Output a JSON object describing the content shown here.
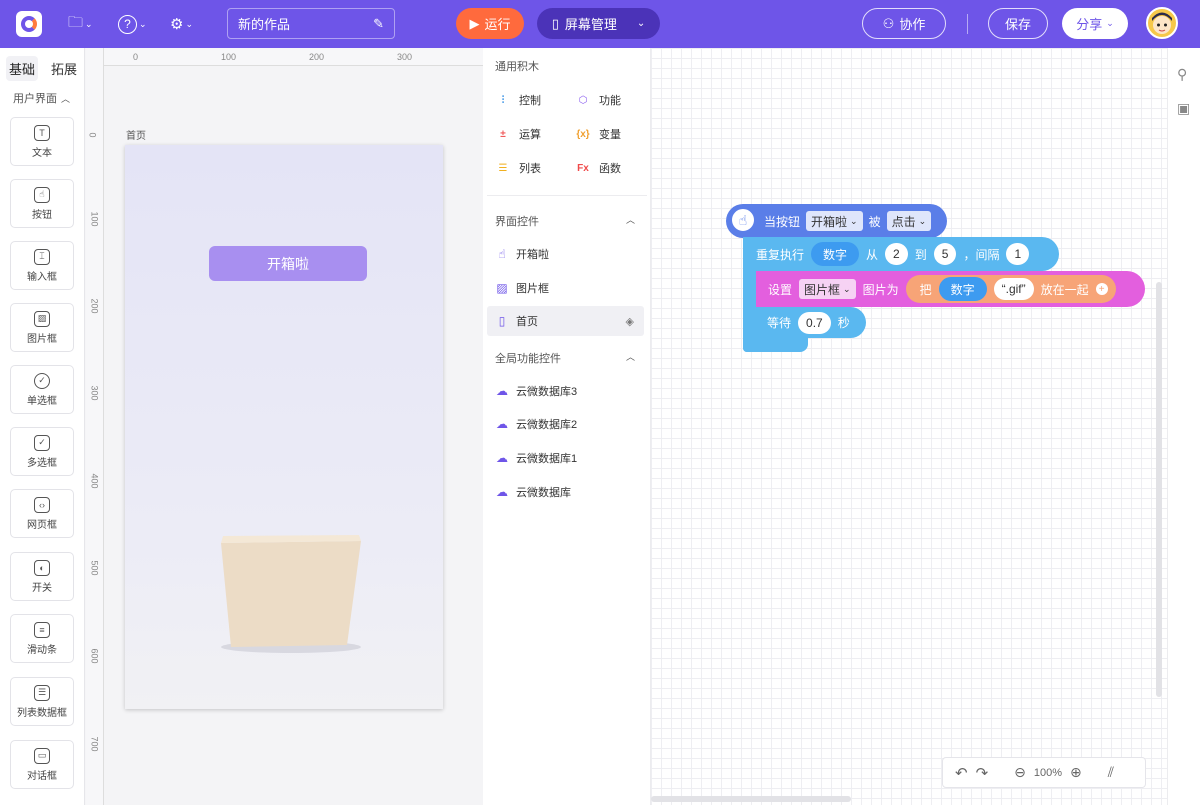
{
  "topbar": {
    "title_value": "新的作品",
    "run_label": "运行",
    "screen_manage_label": "屏幕管理",
    "collab_label": "协作",
    "save_label": "保存",
    "share_label": "分享"
  },
  "left_panel": {
    "tabs": [
      "基础",
      "拓展"
    ],
    "group_title": "用户界面",
    "components": [
      "文本",
      "按钮",
      "输入框",
      "图片框",
      "单选框",
      "多选框",
      "网页框",
      "开关",
      "滑动条",
      "列表数据框",
      "对话框"
    ]
  },
  "canvas": {
    "ruler_top": [
      "0",
      "100",
      "200",
      "300"
    ],
    "ruler_left": [
      "0",
      "100",
      "200",
      "300",
      "400",
      "500",
      "600",
      "700"
    ],
    "page_label": "首页",
    "button_label": "开箱啦"
  },
  "palette": {
    "title": "通用积木",
    "categories": [
      {
        "label": "控制",
        "color": "#2f8de4"
      },
      {
        "label": "功能",
        "color": "#8a5cf0"
      },
      {
        "label": "运算",
        "color": "#f05a5a"
      },
      {
        "label": "变量",
        "color": "#f0a030"
      },
      {
        "label": "列表",
        "color": "#f0b020"
      },
      {
        "label": "函数",
        "color": "#f04a4a"
      }
    ],
    "ui_controls_title": "界面控件",
    "ui_controls": [
      "开箱啦",
      "图片框",
      "首页"
    ],
    "global_controls_title": "全局功能控件",
    "global_controls": [
      "云微数据库3",
      "云微数据库2",
      "云微数据库1",
      "云微数据库"
    ]
  },
  "blocks": {
    "event": {
      "prefix": "当按钮",
      "target": "开箱啦",
      "mid": "被",
      "action": "点击"
    },
    "repeat": {
      "label": "重复执行",
      "var": "数字",
      "from": "从",
      "start": "2",
      "to": "到",
      "end": "5",
      "step_label": "，间隔",
      "step": "1"
    },
    "set_image": {
      "label": "设置",
      "target": "图片框",
      "prop": "图片为",
      "join": "把",
      "var": "数字",
      "suffix": "“.gif”",
      "tail": "放在一起"
    },
    "wait": {
      "label": "等待",
      "value": "0.7",
      "unit": "秒"
    }
  },
  "zoom": {
    "level": "100%"
  }
}
